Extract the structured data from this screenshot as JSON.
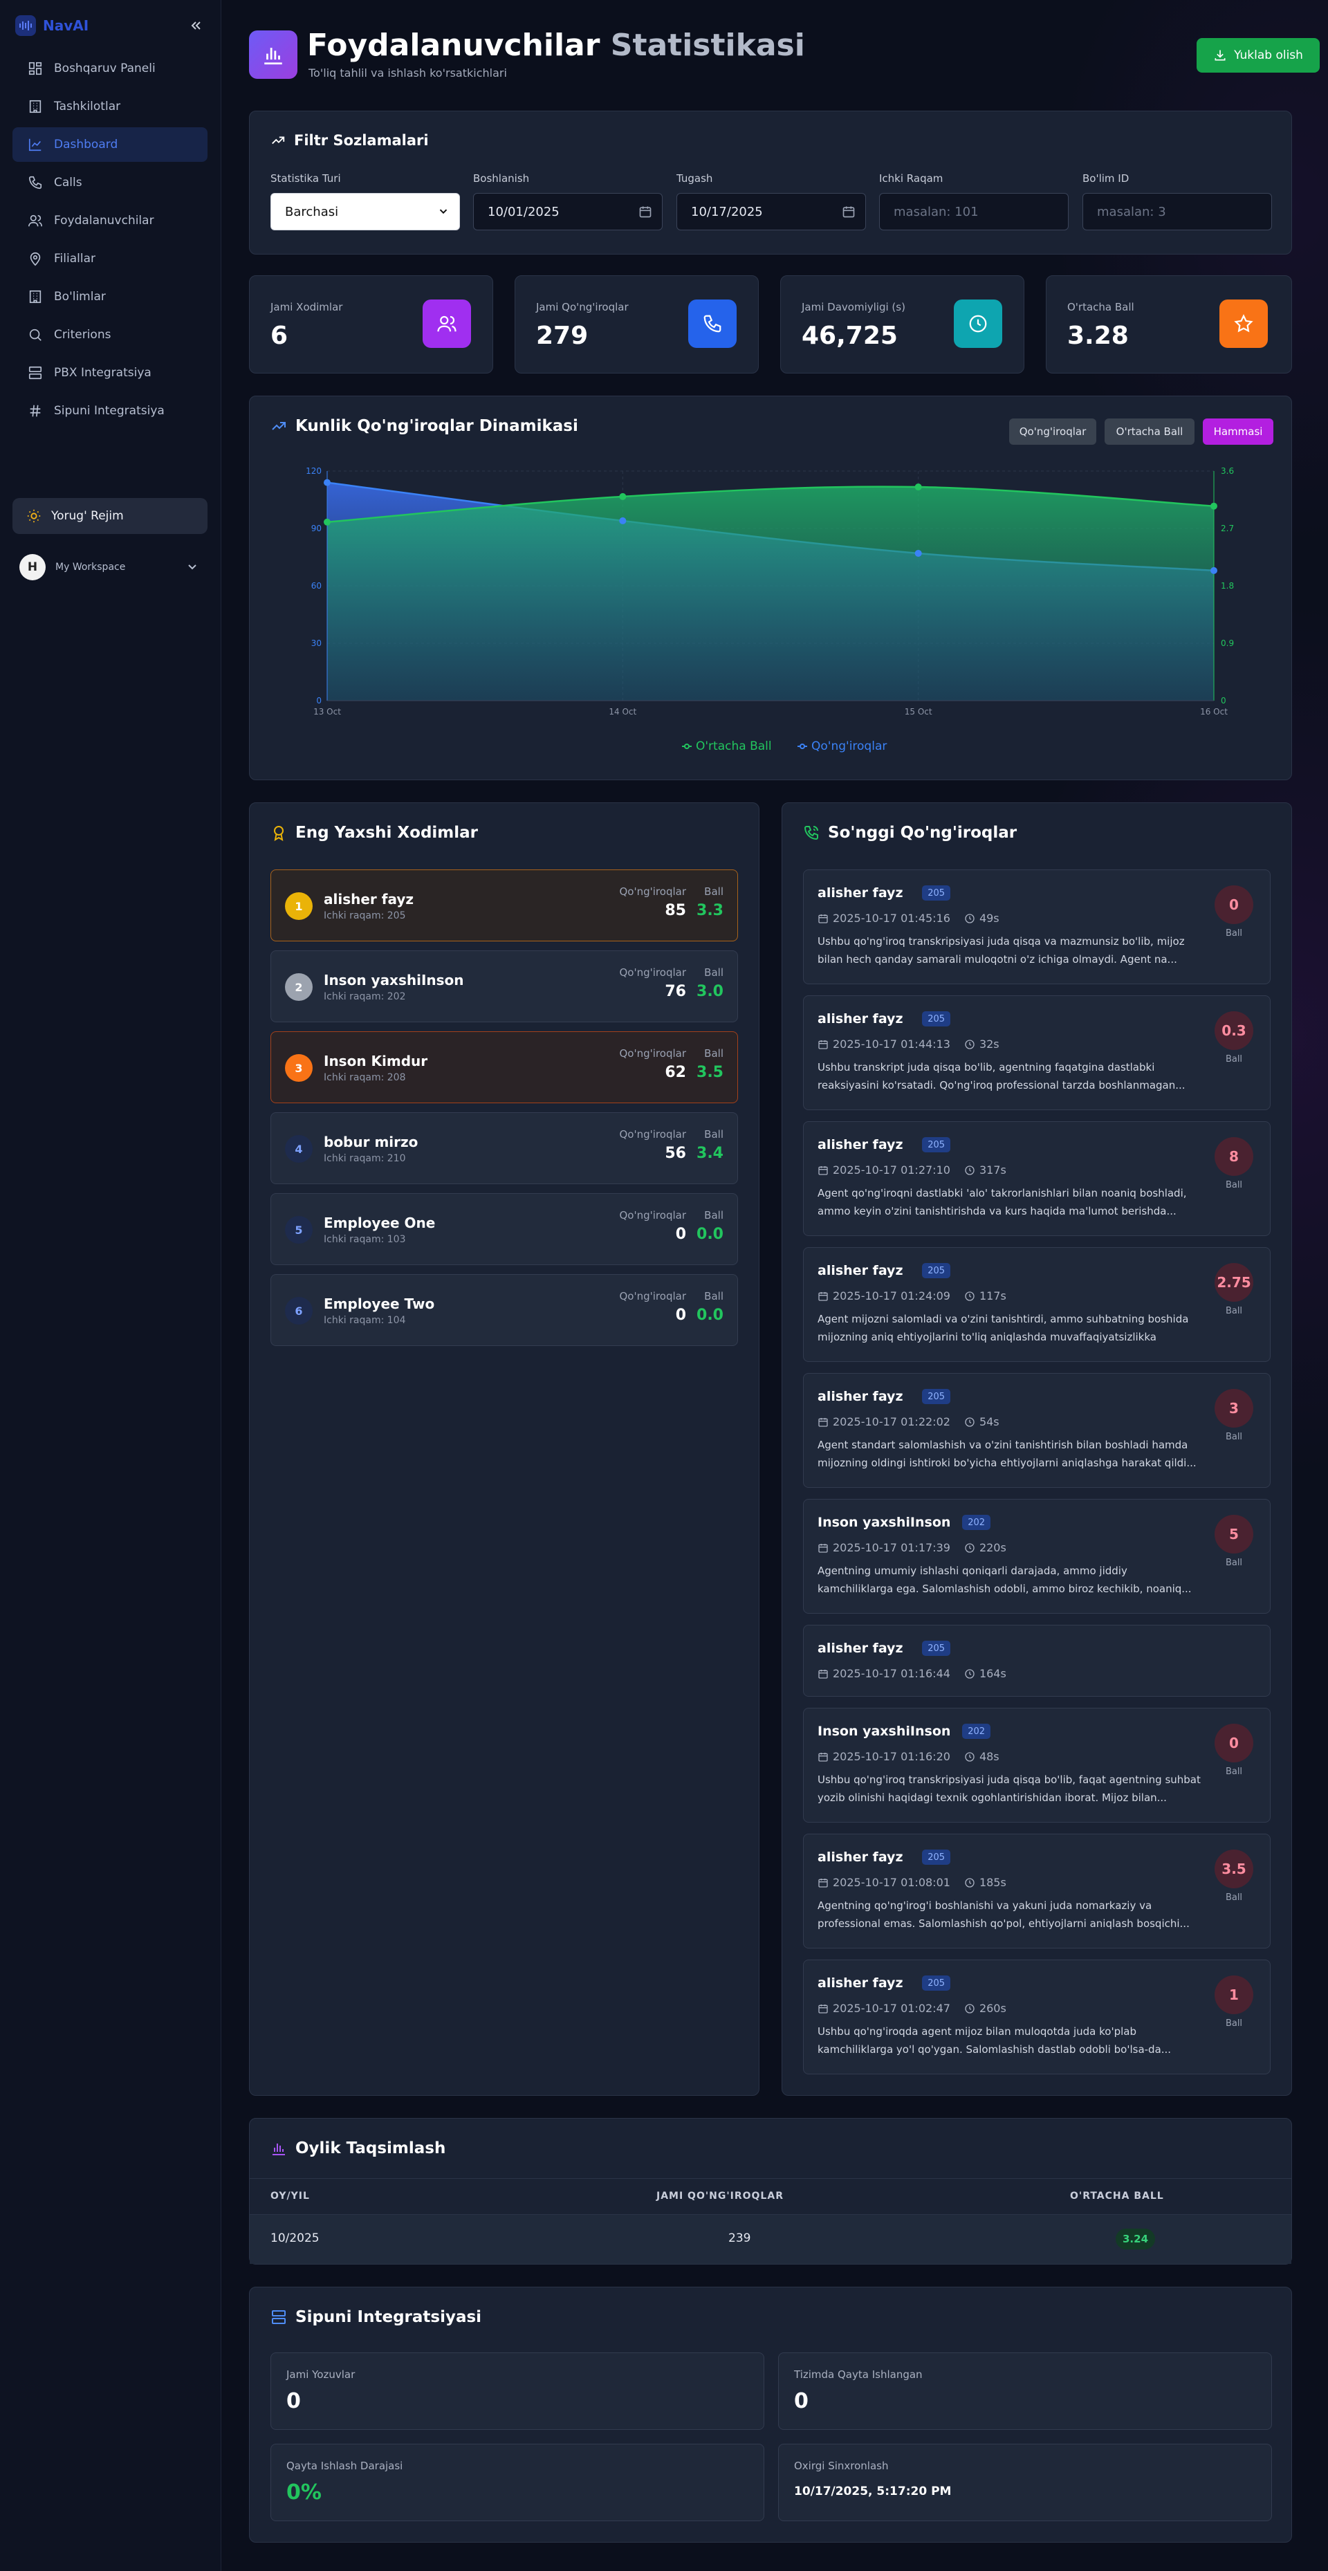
{
  "brand": {
    "name": "NavAI"
  },
  "sidebar": {
    "items": [
      {
        "label": "Boshqaruv Paneli"
      },
      {
        "label": "Tashkilotlar"
      },
      {
        "label": "Dashboard"
      },
      {
        "label": "Calls"
      },
      {
        "label": "Foydalanuvchilar"
      },
      {
        "label": "Filiallar"
      },
      {
        "label": "Bo'limlar"
      },
      {
        "label": "Criterions"
      },
      {
        "label": "PBX Integratsiya"
      },
      {
        "label": "Sipuni Integratsiya"
      }
    ],
    "theme_label": "Yorug' Rejim",
    "workspace_initial": "H",
    "workspace_label": "My Workspace"
  },
  "header": {
    "title_main": "Foydalanuvchilar",
    "title_muted": "Statistikasi",
    "subtitle": "To'liq tahlil va ishlash ko'rsatkichlari",
    "download_label": "Yuklab olish"
  },
  "filters": {
    "title": "Filtr Sozlamalari",
    "type_label": "Statistika Turi",
    "type_value": "Barchasi",
    "start_label": "Boshlanish",
    "start_value": "10/01/2025",
    "end_label": "Tugash",
    "end_value": "10/17/2025",
    "ext_label": "Ichki Raqam",
    "ext_placeholder": "masalan: 101",
    "dept_label": "Bo'lim ID",
    "dept_placeholder": "masalan: 3"
  },
  "stats": [
    {
      "label": "Jami Xodimlar",
      "value": "6"
    },
    {
      "label": "Jami Qo'ng'iroqlar",
      "value": "279"
    },
    {
      "label": "Jami Davomiyligi (s)",
      "value": "46,725"
    },
    {
      "label": "O'rtacha Ball",
      "value": "3.28"
    }
  ],
  "colors": {
    "users_icon": "#a02ff0",
    "calls_icon": "#2563eb",
    "duration_icon": "#0ea5b0",
    "score_icon": "#f97316",
    "series_score": "#22c55e",
    "series_calls": "#3b82f6"
  },
  "chart": {
    "title": "Kunlik Qo'ng'iroqlar Dinamikasi",
    "buttons": [
      "Qo'ng'iroqlar",
      "O'rtacha Ball",
      "Hammasi"
    ]
  },
  "chart_data": {
    "type": "area",
    "categories": [
      "13 Oct",
      "14 Oct",
      "15 Oct",
      "16 Oct"
    ],
    "series": [
      {
        "name": "O'rtacha Ball",
        "axis": "right",
        "values": [
          2.8,
          3.2,
          3.35,
          3.05
        ],
        "color": "#22c55e"
      },
      {
        "name": "Qo'ng'iroqlar",
        "axis": "left",
        "values": [
          114,
          94,
          77,
          68
        ],
        "color": "#3b82f6"
      }
    ],
    "yleft_ticks": [
      "0",
      "30",
      "60",
      "90",
      "120"
    ],
    "yright_ticks": [
      "0",
      "0.9",
      "1.8",
      "2.7",
      "3.6"
    ],
    "yleft_lim": [
      0,
      120
    ],
    "yright_lim": [
      0,
      3.6
    ],
    "legend": "bottom"
  },
  "top_staff": {
    "title": "Eng Yaxshi Xodimlar",
    "calls_label": "Qo'ng'iroqlar",
    "score_label": "Ball",
    "rows": [
      {
        "rank": "1",
        "name": "alisher fayz",
        "ext": "Ichki raqam: 205",
        "calls": "85",
        "score": "3.3"
      },
      {
        "rank": "2",
        "name": "Inson yaxshiInson",
        "ext": "Ichki raqam: 202",
        "calls": "76",
        "score": "3.0"
      },
      {
        "rank": "3",
        "name": "Inson Kimdur",
        "ext": "Ichki raqam: 208",
        "calls": "62",
        "score": "3.5"
      },
      {
        "rank": "4",
        "name": "bobur mirzo",
        "ext": "Ichki raqam: 210",
        "calls": "56",
        "score": "3.4"
      },
      {
        "rank": "5",
        "name": "Employee One",
        "ext": "Ichki raqam: 103",
        "calls": "0",
        "score": "0.0"
      },
      {
        "rank": "6",
        "name": "Employee Two",
        "ext": "Ichki raqam: 104",
        "calls": "0",
        "score": "0.0"
      }
    ]
  },
  "recent_calls": {
    "title": "So'nggi Qo'ng'iroqlar",
    "score_label": "Ball",
    "items": [
      {
        "name": "alisher fayz",
        "ext": "205",
        "time": "2025-10-17 01:45:16",
        "duration": "49s",
        "score": "0",
        "text": "Ushbu qo'ng'iroq transkripsiyasi juda qisqa va mazmunsiz bo'lib, mijoz bilan hech qanday samarali muloqotni o'z ichiga olmaydi. Agent na..."
      },
      {
        "name": "alisher fayz",
        "ext": "205",
        "time": "2025-10-17 01:44:13",
        "duration": "32s",
        "score": "0.3",
        "text": "Ushbu transkript juda qisqa bo'lib, agentning faqatgina dastlabki reaksiyasini ko'rsatadi. Qo'ng'iroq professional tarzda boshlanmagan..."
      },
      {
        "name": "alisher fayz",
        "ext": "205",
        "time": "2025-10-17 01:27:10",
        "duration": "317s",
        "score": "8",
        "text": "Agent qo'ng'iroqni dastlabki 'alo' takrorlanishlari bilan noaniq boshladi, ammo keyin o'zini tanishtirishda va kurs haqida ma'lumot berishda..."
      },
      {
        "name": "alisher fayz",
        "ext": "205",
        "time": "2025-10-17 01:24:09",
        "duration": "117s",
        "score": "2.75",
        "text": "Agent mijozni salomladi va o'zini tanishtirdi, ammo suhbatning boshida mijozning aniq ehtiyojlarini to'liq aniqlashda muvaffaqiyatsizlikka uchrad..."
      },
      {
        "name": "alisher fayz",
        "ext": "205",
        "time": "2025-10-17 01:22:02",
        "duration": "54s",
        "score": "3",
        "text": "Agent standart salomlashish va o'zini tanishtirish bilan boshladi hamda mijozning oldingi ishtiroki bo'yicha ehtiyojlarni aniqlashga harakat qildi..."
      },
      {
        "name": "Inson yaxshiInson",
        "ext": "202",
        "time": "2025-10-17 01:17:39",
        "duration": "220s",
        "score": "5",
        "text": "Agentning umumiy ishlashi qoniqarli darajada, ammo jiddiy kamchiliklarga ega. Salomlashish odobli, ammo biroz kechikib, noaniq..."
      },
      {
        "name": "alisher fayz",
        "ext": "205",
        "time": "2025-10-17 01:16:44",
        "duration": "164s",
        "score": "",
        "text": ""
      },
      {
        "name": "Inson yaxshiInson",
        "ext": "202",
        "time": "2025-10-17 01:16:20",
        "duration": "48s",
        "score": "0",
        "text": "Ushbu qo'ng'iroq transkripsiyasi juda qisqa bo'lib, faqat agentning suhbat yozib olinishi haqidagi texnik ogohlantirishidan iborat. Mijoz bilan..."
      },
      {
        "name": "alisher fayz",
        "ext": "205",
        "time": "2025-10-17 01:08:01",
        "duration": "185s",
        "score": "3.5",
        "text": "Agentning qo'ng'irog'i boshlanishi va yakuni juda nomarkaziy va professional emas. Salomlashish qo'pol, ehtiyojlarni aniqlash bosqichi..."
      },
      {
        "name": "alisher fayz",
        "ext": "205",
        "time": "2025-10-17 01:02:47",
        "duration": "260s",
        "score": "1",
        "text": "Ushbu qo'ng'iroqda agent mijoz bilan muloqotda juda ko'plab kamchiliklarga yo'l qo'ygan. Salomlashish dastlab odobli bo'lsa-da..."
      }
    ]
  },
  "monthly": {
    "title": "Oylik Taqsimlash",
    "headers": [
      "OY/YIL",
      "JAMI QO'NG'IROQLAR",
      "O'RTACHA BALL"
    ],
    "rows": [
      {
        "month": "10/2025",
        "calls": "239",
        "score": "3.24"
      }
    ]
  },
  "sipuni": {
    "title": "Sipuni Integratsiyasi",
    "total_label": "Jami Yozuvlar",
    "total_value": "0",
    "reprocessed_label": "Tizimda Qayta Ishlangan",
    "reprocessed_value": "0",
    "rate_label": "Qayta Ishlash Darajasi",
    "rate_value": "0%",
    "sync_label": "Oxirgi Sinxronlash",
    "sync_value": "10/17/2025, 5:17:20 PM"
  }
}
